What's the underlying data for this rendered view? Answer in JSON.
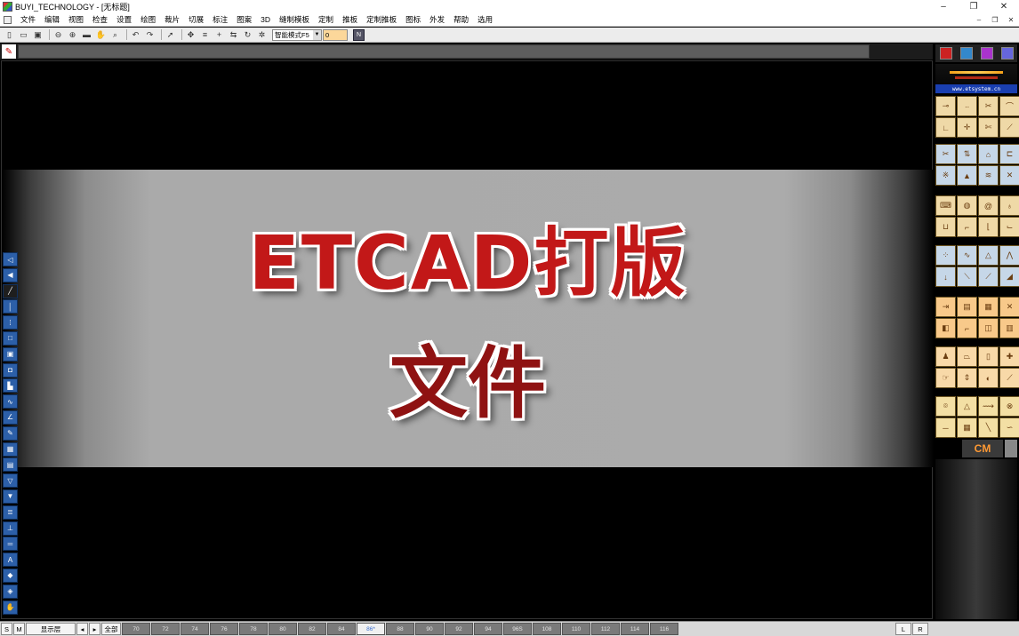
{
  "window": {
    "title": "BUYI_TECHNOLOGY - [无标题]",
    "controls": {
      "minimize": "–",
      "maximize": "❐",
      "close": "✕"
    }
  },
  "menubar": {
    "items": [
      "文件",
      "编辑",
      "视图",
      "检查",
      "设置",
      "绘图",
      "裁片",
      "切展",
      "标注",
      "图案",
      "3D",
      "缝制模板",
      "定制",
      "推板",
      "定制推板",
      "图标",
      "外发",
      "帮助",
      "选用"
    ],
    "mdi": {
      "minimize": "–",
      "restore": "❐",
      "close": "✕"
    }
  },
  "toolbar": {
    "mode_select": "智能模式F5",
    "value_input": "0"
  },
  "banner": {
    "line1": "ETCAD打版",
    "line2": "文件"
  },
  "right_panel": {
    "url": "www.etsystem.cn",
    "unit_label": "CM"
  },
  "statusbar": {
    "s_btn": "S",
    "m_btn": "M",
    "layer_label": "显示层",
    "prev": "◂",
    "next": "▸",
    "all_label": "全部",
    "sizes": [
      "70",
      "72",
      "74",
      "76",
      "78",
      "80",
      "82",
      "84",
      "86*",
      "88",
      "90",
      "92",
      "94",
      "96S",
      "108",
      "110",
      "112",
      "114",
      "116"
    ],
    "active_size": "86*",
    "l_btn": "L",
    "r_btn": "R"
  },
  "colors": {
    "title_red": "#c21818",
    "title_dark_red": "#8f1212",
    "banner_gray": "#ababab",
    "tool_blue": "#2c5fa8",
    "panel_beige": "#efd9a7"
  }
}
